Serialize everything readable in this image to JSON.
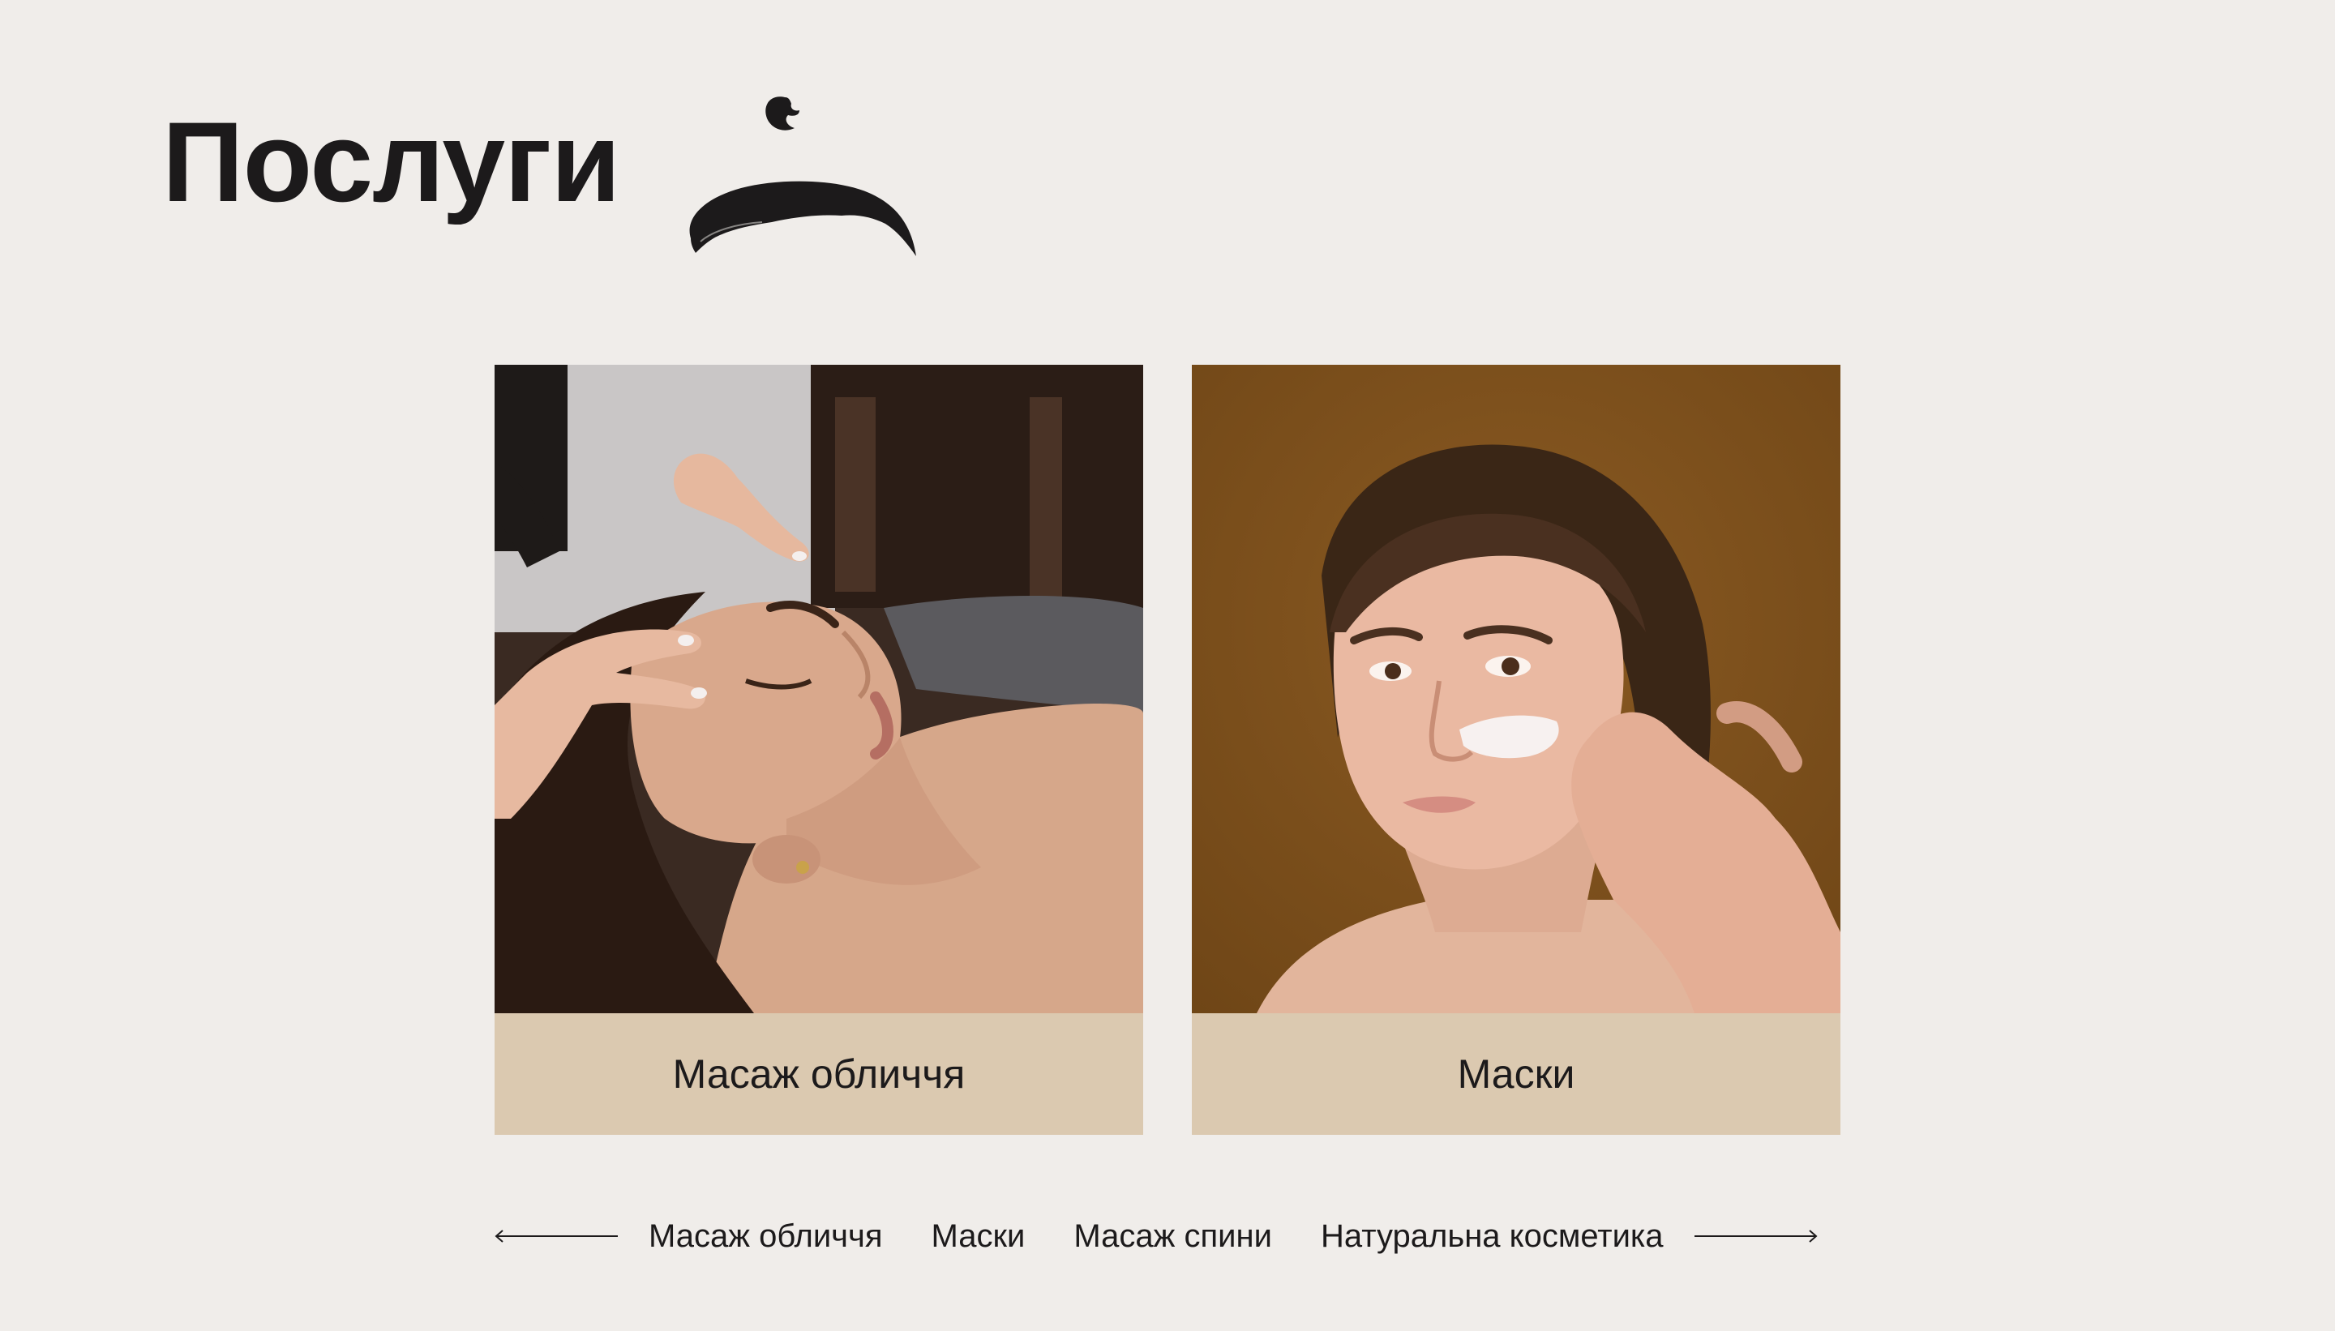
{
  "header": {
    "title": "Послуги"
  },
  "cards": [
    {
      "label": "Масаж обличчя",
      "image": "face-massage-photo"
    },
    {
      "label": "Маски",
      "image": "face-mask-photo"
    }
  ],
  "nav": {
    "items": [
      "Масаж обличчя",
      "Маски",
      "Масаж спини",
      "Натуральна косметика"
    ]
  },
  "colors": {
    "background": "#f0edea",
    "card_caption": "#dbc9b0",
    "text": "#1c1a1b"
  }
}
